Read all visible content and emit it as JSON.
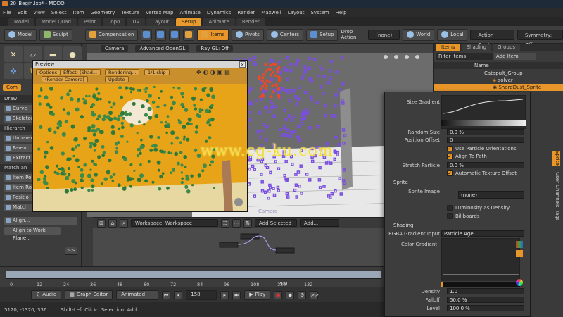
{
  "window": {
    "title": "20_Begin.lxo* - MODO"
  },
  "menu": [
    "File",
    "Edit",
    "View",
    "Select",
    "Item",
    "Geometry",
    "Texture",
    "Vertex Map",
    "Animate",
    "Dynamics",
    "Render",
    "Maxwell",
    "Layout",
    "System",
    "Help"
  ],
  "layout_tabs": [
    "Model",
    "Model Quad",
    "Paint",
    "Topo",
    "UV",
    "Layout",
    "Setup",
    "Animate",
    "Render"
  ],
  "active_layout_tab": "Setup",
  "toolbar": {
    "model": "Model",
    "sculpt": "Sculpt",
    "compensation": "Compensation",
    "items": "Items",
    "pivots": "Pivots",
    "centers": "Centers",
    "setup": "Setup",
    "drop_action_label": "Drop Action",
    "drop_action_value": "(none)",
    "world": "World",
    "local": "Local",
    "action_center": "Action Center",
    "symmetry": "Symmetry: Off"
  },
  "left_panel": {
    "tab": "Com",
    "draw_section": "Draw",
    "curve_button": "Curve",
    "skeleton_button": "Skeleton",
    "hierarchy_section": "Hierarch",
    "unparent_button": "Unparent",
    "parent_button": "Parent",
    "extract_button": "Extract",
    "match_section": "Match an",
    "item_position": "Item Po",
    "item_rotation": "Item Ro",
    "position_button": "Positio",
    "match_button": "Match",
    "align_button": "Align...",
    "align_work_plane": "Align to Work Plane...",
    "more": ">>"
  },
  "viewport": {
    "camera": "Camera",
    "mode": "Advanced OpenGL",
    "ray_gl": "Ray GL: Off",
    "footer_label": "Camera"
  },
  "preview": {
    "title": "Preview",
    "options": "Options",
    "effect": "Effect: (Shad...",
    "rendering": "Rendering...",
    "display": "1/1 skip",
    "render_camera": "(Render Camera)",
    "update": "Update"
  },
  "schematic": {
    "workspace": "Workspace: Workspace",
    "add_selected": "Add Selected",
    "add": "Add..."
  },
  "timeline": {
    "ticks": [
      "0",
      "12",
      "24",
      "36",
      "48",
      "60",
      "72",
      "84",
      "96",
      "108",
      "120",
      "132"
    ],
    "start": "0",
    "end": "200"
  },
  "playbar": {
    "audio": "Audio",
    "graph_editor": "Graph Editor",
    "animated": "Animated",
    "frame": "158",
    "play": "Play",
    "more": ">>"
  },
  "status": {
    "coords": "5120, -1320, 336",
    "hint_key": "Shift-Left Click:",
    "hint_action": "Selection: Add"
  },
  "item_list": {
    "tabs": [
      "Items",
      "Shading",
      "Groups"
    ],
    "filter": "Filter Items",
    "add_item": "Add Item",
    "column_name": "Name",
    "rows": [
      "Catapult_Group",
      "solver",
      "ShardDust_Sprite"
    ]
  },
  "properties": {
    "size_gradient": "Size Gradient",
    "random_size": "Random Size",
    "random_size_value": "0.0 %",
    "position_offset": "Position Offset",
    "position_offset_value": "0",
    "use_particle_orientations": "Use Particle Orientations",
    "align_to_path": "Align To Path",
    "stretch_particle": "Stretch Particle",
    "stretch_particle_value": "0.0 %",
    "automatic_texture_offset": "Automatic Texture Offset",
    "sprite_section": "Sprite",
    "sprite_image": "Sprite Image",
    "sprite_image_value": "(none)",
    "luminosity_as_density": "Luminosity as Density",
    "billboards": "Billboards",
    "shading_section": "Shading",
    "rgba_gradient_input": "RGBA Gradient Input",
    "rgba_gradient_value": "Particle Age",
    "color_gradient": "Color Gradient",
    "density": "Density",
    "density_value": "1.0",
    "falloff": "Falloff",
    "falloff_value": "50.0 %",
    "level": "Level",
    "level_value": "100.0 %"
  },
  "right_strip": {
    "tabs": [
      "Sprite",
      "User Channels",
      "Tags"
    ]
  },
  "watermark": "www.cg-ku.com",
  "colors": {
    "accent": "#e8962a",
    "render_bg": "#e8a419",
    "particles_green": "#3d8a4a",
    "particles_purple": "#7a4fe0",
    "particles_red": "#e84a2a"
  }
}
